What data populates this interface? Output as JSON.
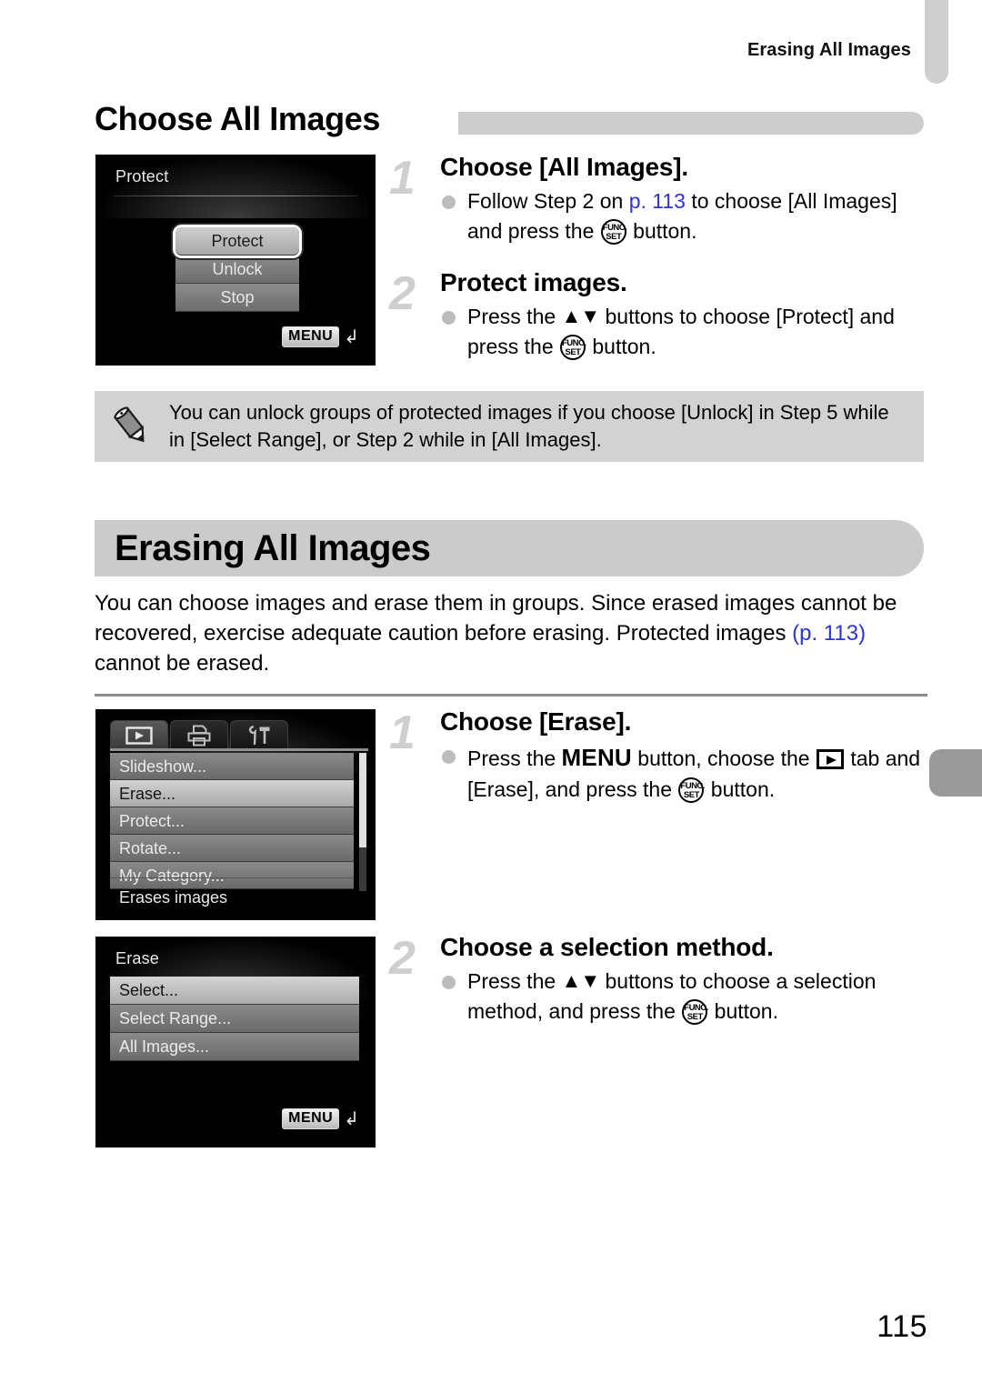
{
  "header": {
    "running_title": "Erasing All Images",
    "page_number": "115"
  },
  "subsection": {
    "title": "Choose All Images"
  },
  "protect_screen": {
    "title": "Protect",
    "options": [
      "Protect",
      "Unlock",
      "Stop"
    ],
    "selected": "Protect",
    "menu_badge": "MENU"
  },
  "steps_protect": [
    {
      "number": "1",
      "title": "Choose [All Images].",
      "body_parts": {
        "p1": "Follow Step 2 on ",
        "ref": "p. 113",
        "p2": " to choose [All Images] and press the ",
        "p3": " button."
      }
    },
    {
      "number": "2",
      "title": "Protect images.",
      "body_parts": {
        "p1": "Press the ",
        "arrows": "▲▼",
        "p2": " buttons to choose [Protect] and press the ",
        "p3": " button."
      }
    }
  ],
  "note": {
    "icon": "pencil-icon",
    "text": "You can unlock groups of protected images if you choose [Unlock] in Step 5 while in [Select Range], or Step 2 while in [All Images]."
  },
  "section": {
    "title": "Erasing All Images",
    "intro_parts": {
      "p1": "You can choose images and erase them in groups. Since erased images cannot be recovered, exercise adequate caution before erasing. Protected images ",
      "ref": "(p. 113)",
      "p2": " cannot be erased."
    }
  },
  "playback_menu_screen": {
    "tabs": [
      "playback-tab",
      "print-tab",
      "settings-tab"
    ],
    "active_tab": "playback-tab",
    "items": [
      "Slideshow...",
      "Erase...",
      "Protect...",
      "Rotate...",
      "My Category..."
    ],
    "selected": "Erase...",
    "hint": "Erases images"
  },
  "erase_screen": {
    "title": "Erase",
    "options": [
      "Select...",
      "Select Range...",
      "All Images..."
    ],
    "selected": "Select...",
    "menu_badge": "MENU"
  },
  "steps_erase": [
    {
      "number": "1",
      "title": "Choose [Erase].",
      "body_parts": {
        "p1": "Press the ",
        "menu": "MENU",
        "p2": " button, choose the ",
        "p3": " tab and [Erase], and press the ",
        "p4": " button."
      }
    },
    {
      "number": "2",
      "title": "Choose a selection method.",
      "body_parts": {
        "p1": "Press the ",
        "arrows": "▲▼",
        "p2": " buttons to choose a selection method, and press the ",
        "p3": " button."
      }
    }
  ],
  "glyphs": {
    "funcset_top": "FUNC.",
    "funcset_bottom": "SET"
  },
  "colors": {
    "link": "#2c34d8",
    "banner_gray": "#cbcbcb",
    "note_gray": "#d2d2d2",
    "step_number_gray": "#cfcfcf"
  }
}
